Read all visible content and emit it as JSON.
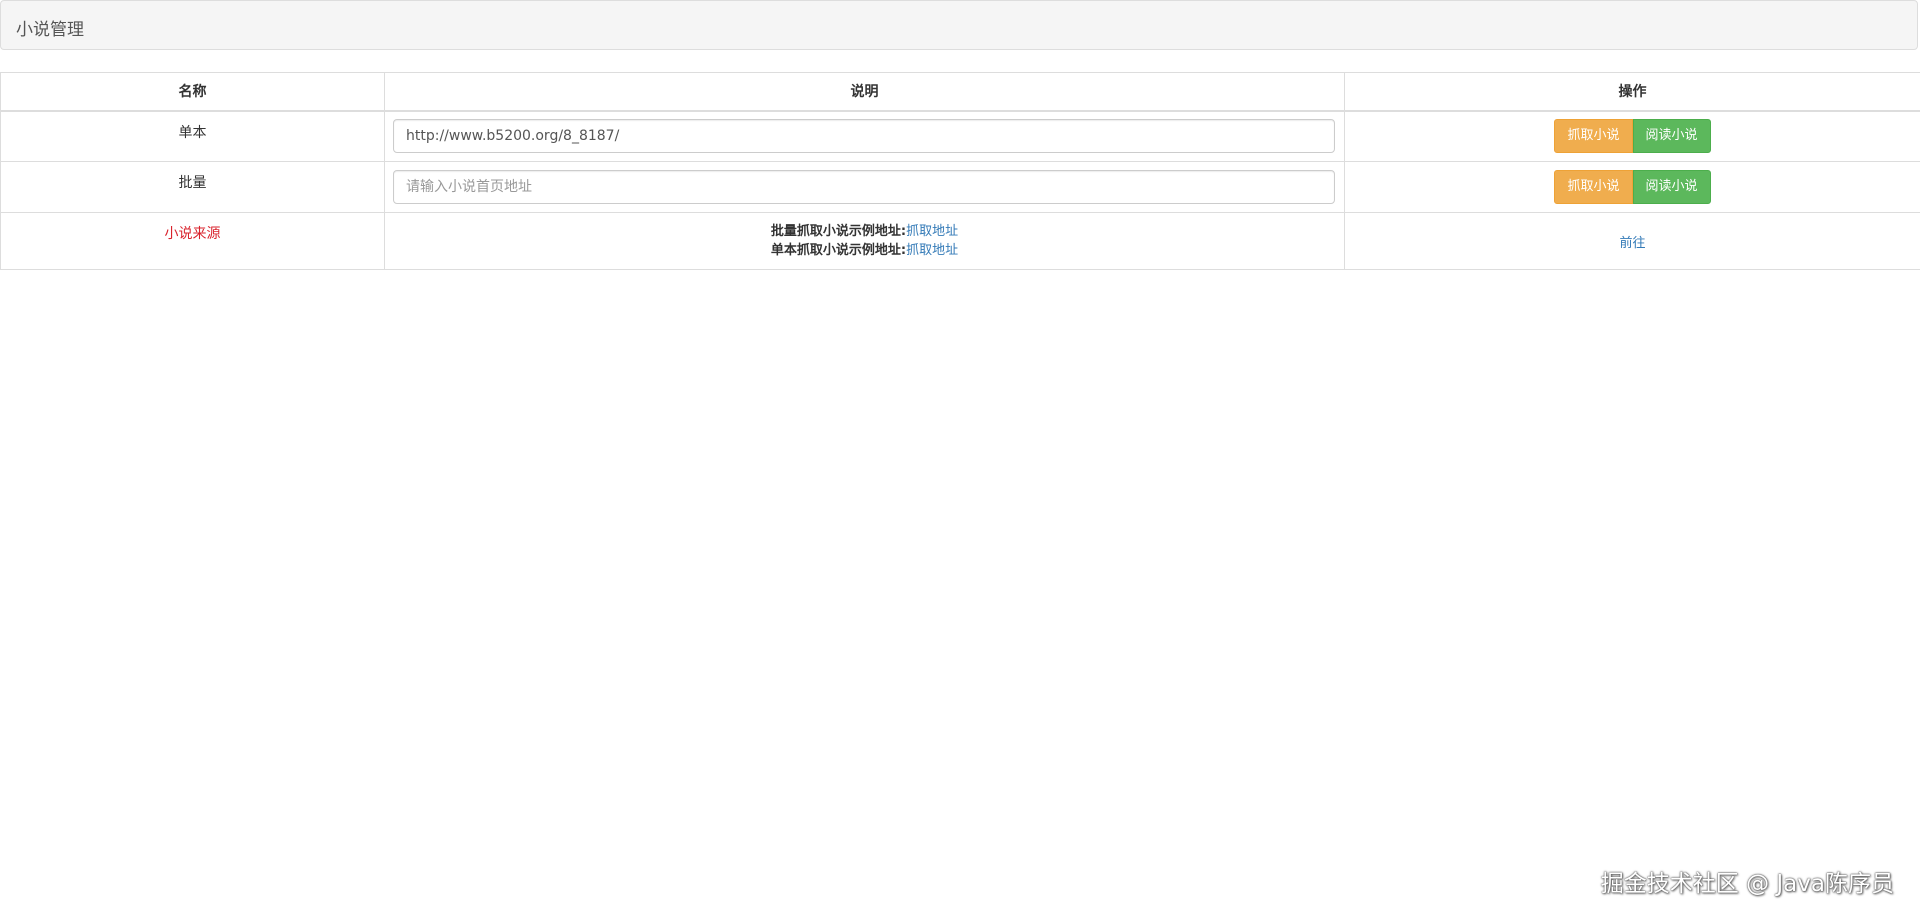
{
  "header": {
    "title": "小说管理"
  },
  "table": {
    "columns": [
      "名称",
      "说明",
      "操作"
    ],
    "rows": [
      {
        "name": "单本",
        "input_value": "http://www.b5200.org/8_8187/",
        "input_placeholder": "",
        "fetch_label": "抓取小说",
        "read_label": "阅读小说"
      },
      {
        "name": "批量",
        "input_value": "",
        "input_placeholder": "请输入小说首页地址",
        "fetch_label": "抓取小说",
        "read_label": "阅读小说"
      }
    ],
    "source_row": {
      "name": "小说来源",
      "batch_example_label": "批量抓取小说示例地址:",
      "batch_example_link": "抓取地址",
      "single_example_label": "单本抓取小说示例地址:",
      "single_example_link": "抓取地址",
      "go_link": "前往"
    }
  },
  "watermark": "掘金技术社区 @ Java陈序员",
  "colors": {
    "warning": "#f0ad4e",
    "success": "#5cb85c",
    "link": "#337ab7",
    "red": "#d9232d"
  }
}
